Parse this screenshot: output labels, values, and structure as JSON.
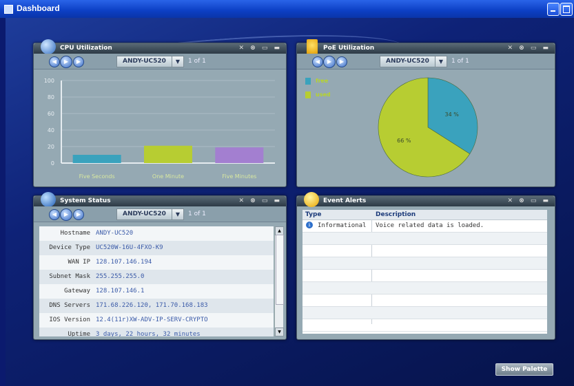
{
  "window": {
    "title": "Dashboard"
  },
  "colors": {
    "accent": "#2a64e8",
    "bar_blue": "#3aa2bd",
    "bar_green": "#b7cd32",
    "bar_purple": "#a37fd0",
    "pie_free": "#3aa2bd",
    "pie_used": "#b7cd32"
  },
  "cpu": {
    "title": "CPU Utilization",
    "device": "ANDY-UC520",
    "pager": "1 of 1",
    "icon": "cpu-icon"
  },
  "poe": {
    "title": "PoE Utilization",
    "device": "ANDY-UC520",
    "pager": "1 of 1",
    "icon": "lightning-icon",
    "legend": [
      {
        "label": "free"
      },
      {
        "label": "used"
      }
    ]
  },
  "system": {
    "title": "System Status",
    "device": "ANDY-UC520",
    "pager": "1 of 1",
    "icon": "globe-icon",
    "rows": [
      {
        "label": "Hostname",
        "value": "ANDY-UC520"
      },
      {
        "label": "Device Type",
        "value": "UC520W-16U-4FXO-K9"
      },
      {
        "label": "WAN IP",
        "value": "128.107.146.194"
      },
      {
        "label": "Subnet Mask",
        "value": "255.255.255.0"
      },
      {
        "label": "Gateway",
        "value": "128.107.146.1"
      },
      {
        "label": "DNS Servers",
        "value": "171.68.226.120, 171.70.168.183"
      },
      {
        "label": "IOS Version",
        "value": "12.4(11r)XW-ADV-IP-SERV-CRYPTO"
      },
      {
        "label": "Uptime",
        "value": "3 days, 22 hours, 32 minutes"
      }
    ]
  },
  "events": {
    "title": "Event Alerts",
    "icon": "alert-icon",
    "headers": {
      "type": "Type",
      "description": "Description"
    },
    "rows": [
      {
        "type": "Informational",
        "description": "Voice related data is loaded."
      }
    ]
  },
  "palette_button": "Show Palette",
  "chart_data": [
    {
      "type": "bar",
      "categories": [
        "Five Seconds",
        "One Minute",
        "Five Minutes"
      ],
      "values": [
        10,
        21,
        19
      ],
      "ylim": [
        0,
        100
      ],
      "yticks": [
        0,
        20,
        40,
        60,
        80,
        100
      ],
      "series": [
        {
          "values": [
            10,
            21,
            19
          ]
        }
      ]
    },
    {
      "type": "pie",
      "labels": [
        "free",
        "used"
      ],
      "values": [
        34,
        66
      ],
      "data_labels": [
        "34 %",
        "66 %"
      ]
    }
  ]
}
